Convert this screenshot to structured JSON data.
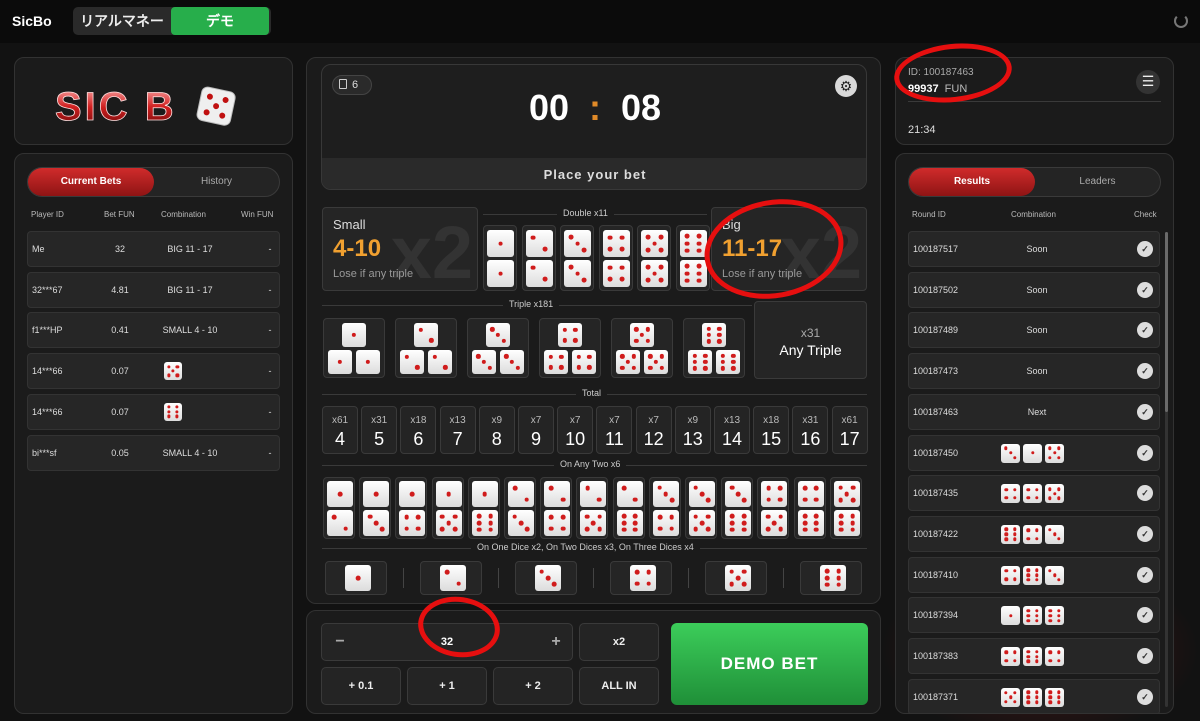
{
  "app": {
    "title": "SicBo",
    "mode_real": "リアルマネー",
    "mode_demo": "デモ"
  },
  "logo": {
    "text": "SIC B"
  },
  "left": {
    "tabs": [
      "Current Bets",
      "History"
    ],
    "columns": [
      "Player ID",
      "Bet FUN",
      "Combination",
      "Win FUN"
    ],
    "rows": [
      {
        "player": "Me",
        "bet": "32",
        "combo": "BIG 11 - 17",
        "win": "-"
      },
      {
        "player": "32***67",
        "bet": "4.81",
        "combo": "BIG 11 - 17",
        "win": "-"
      },
      {
        "player": "f1***HP",
        "bet": "0.41",
        "combo": "SMALL 4 - 10",
        "win": "-"
      },
      {
        "player": "14***66",
        "bet": "0.07",
        "combo": "",
        "die": 5,
        "win": "-"
      },
      {
        "player": "14***66",
        "bet": "0.07",
        "combo": "",
        "die": 6,
        "win": "-"
      },
      {
        "player": "bi***sf",
        "bet": "0.05",
        "combo": "SMALL 4 - 10",
        "win": "-"
      }
    ]
  },
  "game": {
    "counter": "6",
    "timer_min": "00",
    "timer_sep": ":",
    "timer_sec": "08",
    "status": "Place your bet",
    "small": {
      "title": "Small",
      "range": "4-10",
      "note": "Lose if any triple",
      "mult": "x2"
    },
    "big": {
      "title": "Big",
      "range": "11-17",
      "note": "Lose if any triple",
      "mult": "x2"
    },
    "double_label": "Double x11",
    "triple_label": "Triple x181",
    "any_triple": {
      "mult": "x31",
      "label": "Any Triple"
    },
    "total_label": "Total",
    "totals": [
      {
        "mult": "x61",
        "num": "4"
      },
      {
        "mult": "x31",
        "num": "5"
      },
      {
        "mult": "x18",
        "num": "6"
      },
      {
        "mult": "x13",
        "num": "7"
      },
      {
        "mult": "x9",
        "num": "8"
      },
      {
        "mult": "x7",
        "num": "9"
      },
      {
        "mult": "x7",
        "num": "10"
      },
      {
        "mult": "x7",
        "num": "11"
      },
      {
        "mult": "x7",
        "num": "12"
      },
      {
        "mult": "x9",
        "num": "13"
      },
      {
        "mult": "x13",
        "num": "14"
      },
      {
        "mult": "x18",
        "num": "15"
      },
      {
        "mult": "x31",
        "num": "16"
      },
      {
        "mult": "x61",
        "num": "17"
      }
    ],
    "two_label": "On Any Two x6",
    "one_label": "On One Dice x2, On Two Dices x3, On Three Dices x4"
  },
  "bet": {
    "minus": "−",
    "amount": "32",
    "plus": "+",
    "x2": "x2",
    "add01": "+ 0.1",
    "add1": "+ 1",
    "add2": "+ 2",
    "allin": "ALL IN",
    "demo_bet": "DEMO BET"
  },
  "account": {
    "id": "ID: 100187463",
    "balance": "99937",
    "currency": "FUN",
    "time": "21:34"
  },
  "right": {
    "tabs": [
      "Results",
      "Leaders"
    ],
    "columns": [
      "Round ID",
      "Combination",
      "Check"
    ],
    "rows": [
      {
        "id": "100187517",
        "text": "Soon"
      },
      {
        "id": "100187502",
        "text": "Soon"
      },
      {
        "id": "100187489",
        "text": "Soon"
      },
      {
        "id": "100187473",
        "text": "Soon"
      },
      {
        "id": "100187463",
        "text": "Next"
      },
      {
        "id": "100187450",
        "dice": [
          3,
          1,
          5
        ]
      },
      {
        "id": "100187435",
        "dice": [
          4,
          4,
          5
        ]
      },
      {
        "id": "100187422",
        "dice": [
          6,
          4,
          3
        ]
      },
      {
        "id": "100187410",
        "dice": [
          4,
          6,
          3
        ]
      },
      {
        "id": "100187394",
        "dice": [
          1,
          6,
          6
        ]
      },
      {
        "id": "100187383",
        "dice": [
          4,
          6,
          4
        ]
      },
      {
        "id": "100187371",
        "dice": [
          5,
          6,
          6
        ]
      }
    ]
  },
  "colors": {
    "accent_red": "#d02b2b",
    "accent_orange": "#f0a030",
    "demo_green": "#2cb24a",
    "pip_red": "#d01c1c"
  }
}
